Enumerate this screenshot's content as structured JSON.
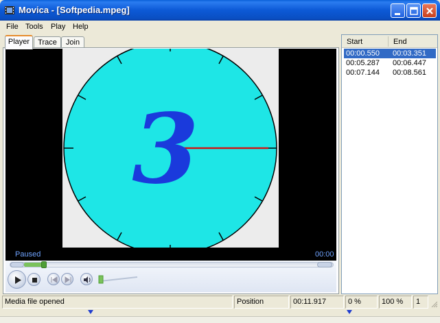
{
  "window": {
    "title": "Movica - [Softpedia.mpeg]"
  },
  "menu": {
    "items": [
      "File",
      "Tools",
      "Play",
      "Help"
    ]
  },
  "tabs": [
    {
      "label": "Player",
      "active": true
    },
    {
      "label": "Trace",
      "active": false
    },
    {
      "label": "Join",
      "active": false
    }
  ],
  "player": {
    "state": "Paused",
    "time": "00:00",
    "frame_number": "3",
    "seek_position_fraction": 0.12,
    "volume_fraction": 0.05
  },
  "segments": {
    "columns": [
      "Start",
      "End"
    ],
    "rows": [
      {
        "start": "00:00.550",
        "end": "00:03.351",
        "selected": true
      },
      {
        "start": "00:05.287",
        "end": "00:06.447",
        "selected": false
      },
      {
        "start": "00:07.144",
        "end": "00:08.561",
        "selected": false
      }
    ]
  },
  "statusbar": {
    "message": "Media file opened",
    "position_label": "Position",
    "position_value": "00:11.917",
    "percent": "0 %",
    "zoom": "100 %",
    "count": "1"
  },
  "colors": {
    "title_bar": "#0a5fd8",
    "clock_face": "#1ee6e6",
    "digit": "#1a3adc",
    "hand": "#d01414",
    "selection": "#316ac5",
    "marker": "#1f3ccf"
  },
  "icons": {
    "app": "film-icon",
    "minimize": "minimize-icon",
    "maximize": "maximize-icon",
    "close": "close-icon",
    "play": "play-icon",
    "stop": "stop-icon",
    "prev": "previous-icon",
    "next": "next-icon",
    "volume": "speaker-icon"
  }
}
